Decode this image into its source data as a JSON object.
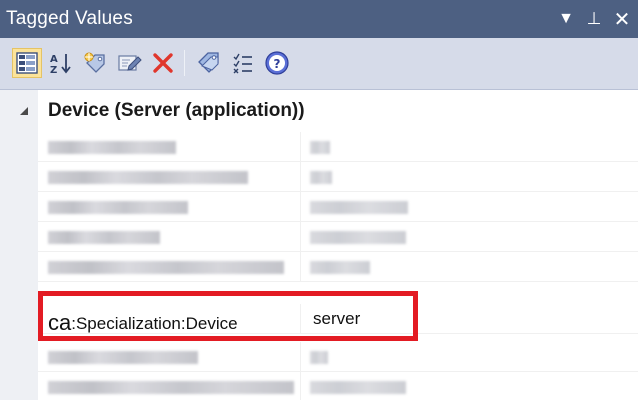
{
  "window": {
    "title": "Tagged Values",
    "menu_glyph": "▼",
    "pin_glyph": "⊥",
    "close_glyph": "✕"
  },
  "toolbar": {
    "buttons": [
      {
        "name": "categorized-view-icon",
        "pressed": true
      },
      {
        "name": "sort-alphabetical-icon",
        "pressed": false
      },
      {
        "name": "new-tag-icon",
        "pressed": false
      },
      {
        "name": "edit-tag-icon",
        "pressed": false
      },
      {
        "name": "delete-icon",
        "pressed": false
      },
      {
        "name": "tag-icon",
        "pressed": false
      },
      {
        "name": "checklist-icon",
        "pressed": false
      },
      {
        "name": "help-icon",
        "pressed": false
      }
    ]
  },
  "grid": {
    "group_label": "Device (Server (application))",
    "highlighted_row": {
      "namespace": "ca",
      "name": ":Specialization:Device",
      "value": "server"
    }
  },
  "colors": {
    "title_bar": "#4d6082",
    "toolbar": "#d6dbe9",
    "highlight_border": "#e31b23"
  }
}
